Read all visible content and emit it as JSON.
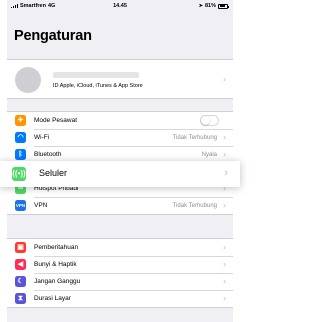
{
  "status_bar": {
    "carrier": "Smartfren",
    "network": "4G",
    "time": "14.45",
    "battery": "81%"
  },
  "page_title": "Pengaturan",
  "profile": {
    "subtitle": "ID Apple, iCloud, iTunes & App Store"
  },
  "group1": [
    {
      "id": "mode-pesawat",
      "label": "Mode Pesawat",
      "icon": "airplane-icon",
      "color": "#ff9500",
      "toggle": false
    },
    {
      "id": "wi-fi",
      "label": "Wi-Fi",
      "value": "Tidak Terhubung",
      "icon": "wifi-icon",
      "color": "#007aff"
    },
    {
      "id": "bluetooth",
      "label": "Bluetooth",
      "value": "Nyala",
      "icon": "bluetooth-icon",
      "color": "#007aff"
    },
    {
      "id": "seluler-hidden",
      "label": "",
      "icon": "cellular-icon",
      "color": "#4cd964"
    },
    {
      "id": "hotspot-pribadi",
      "label": "Hotspot Pribadi",
      "icon": "hotspot-icon",
      "color": "#4cd964"
    },
    {
      "id": "vpn",
      "label": "VPN",
      "value": "Tidak Terhubung",
      "icon": "vpn-icon",
      "color": "#1a73e8"
    }
  ],
  "highlight": {
    "label": "Seluler",
    "icon": "cellular-icon",
    "color": "#4cd964"
  },
  "group2": [
    {
      "id": "pemberitahuan",
      "label": "Pemberitahuan",
      "icon": "notifications-icon",
      "color": "#ff3b30"
    },
    {
      "id": "bunyi-haptik",
      "label": "Bunyi & Haptik",
      "icon": "sounds-icon",
      "color": "#ff2d55"
    },
    {
      "id": "jangan-ganggu",
      "label": "Jangan Ganggu",
      "icon": "moon-icon",
      "color": "#5856d6"
    },
    {
      "id": "durasi-layar",
      "label": "Durasi Layar",
      "icon": "hourglass-icon",
      "color": "#5856d6"
    }
  ]
}
